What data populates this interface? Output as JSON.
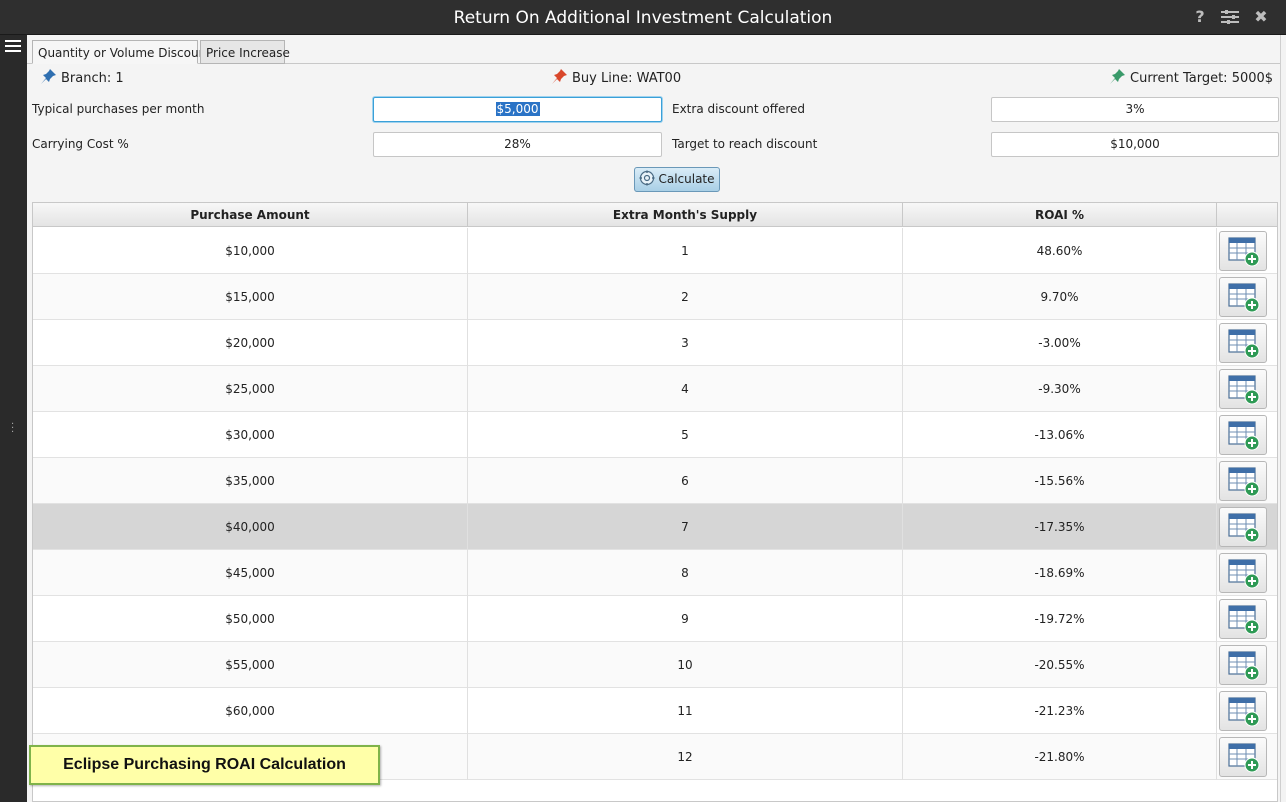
{
  "window": {
    "title": "Return On Additional Investment Calculation",
    "help_label": "?",
    "settings_icon": "sliders-icon",
    "close_label": "✖"
  },
  "tabs": [
    {
      "label": "Quantity or Volume Discount",
      "active": true
    },
    {
      "label": "Price Increase",
      "active": false
    }
  ],
  "info": {
    "branch": "Branch: 1",
    "buy_line": "Buy Line: WAT00",
    "target": "Current Target: 5000$",
    "branch_pin_color": "#2f6fb0",
    "buyline_pin_color": "#d9472b",
    "target_pin_color": "#3a9a6a"
  },
  "form": {
    "typical_label": "Typical purchases per month",
    "typical_value": "$5,000",
    "carrying_label": "Carrying Cost %",
    "carrying_value": "28%",
    "extra_discount_label": "Extra discount offered",
    "extra_discount_value": "3%",
    "target_label": "Target to reach discount",
    "target_value": "$10,000",
    "calculate_label": "Calculate"
  },
  "table": {
    "headers": [
      "Purchase Amount",
      "Extra Month's Supply",
      "ROAI %"
    ],
    "selected_row": 6,
    "rows": [
      {
        "amount": "$10,000",
        "months": "1",
        "roai": "48.60%"
      },
      {
        "amount": "$15,000",
        "months": "2",
        "roai": "9.70%"
      },
      {
        "amount": "$20,000",
        "months": "3",
        "roai": "-3.00%"
      },
      {
        "amount": "$25,000",
        "months": "4",
        "roai": "-9.30%"
      },
      {
        "amount": "$30,000",
        "months": "5",
        "roai": "-13.06%"
      },
      {
        "amount": "$35,000",
        "months": "6",
        "roai": "-15.56%"
      },
      {
        "amount": "$40,000",
        "months": "7",
        "roai": "-17.35%"
      },
      {
        "amount": "$45,000",
        "months": "8",
        "roai": "-18.69%"
      },
      {
        "amount": "$50,000",
        "months": "9",
        "roai": "-19.72%"
      },
      {
        "amount": "$55,000",
        "months": "10",
        "roai": "-20.55%"
      },
      {
        "amount": "$60,000",
        "months": "11",
        "roai": "-21.23%"
      },
      {
        "amount": "",
        "months": "12",
        "roai": "-21.80%"
      }
    ]
  },
  "callout": {
    "text": "Eclipse Purchasing ROAI Calculation"
  }
}
